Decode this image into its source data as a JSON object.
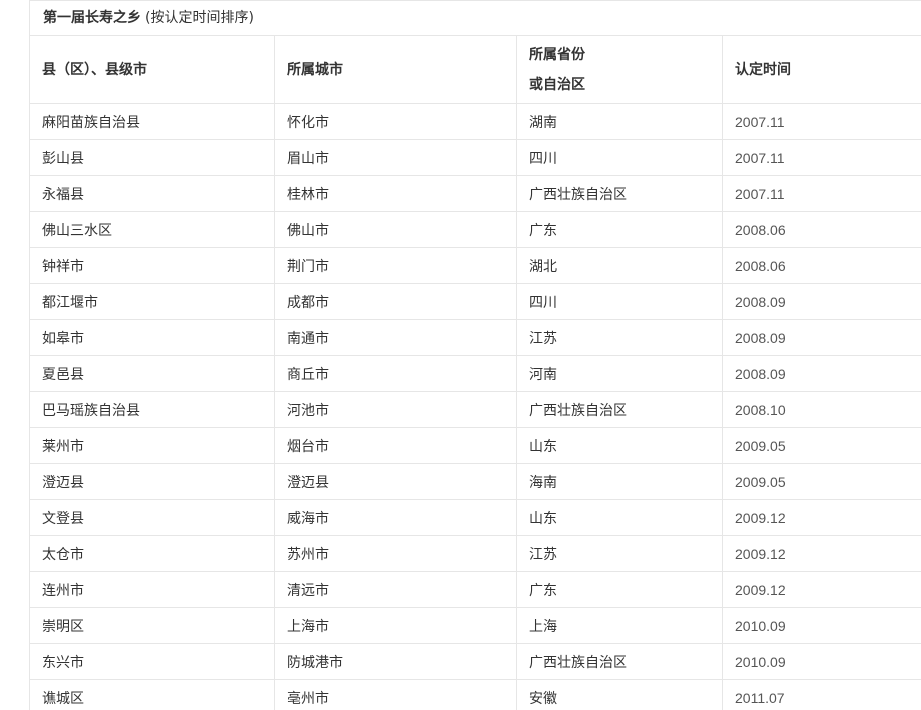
{
  "caption": {
    "title": "第一届长寿之乡",
    "note": "(按认定时间排序)"
  },
  "headers": {
    "county": "县（区）、县级市",
    "city": "所属城市",
    "province_line1": "所属省份",
    "province_line2": "或自治区",
    "date": "认定时间"
  },
  "rows": [
    {
      "county": "麻阳苗族自治县",
      "city": "怀化市",
      "province": "湖南",
      "date": "2007.11"
    },
    {
      "county": "彭山县",
      "city": "眉山市",
      "province": "四川",
      "date": "2007.11"
    },
    {
      "county": "永福县",
      "city": "桂林市",
      "province": "广西壮族自治区",
      "date": "2007.11"
    },
    {
      "county": "佛山三水区",
      "city": "佛山市",
      "province": "广东",
      "date": "2008.06"
    },
    {
      "county": "钟祥市",
      "city": "荆门市",
      "province": "湖北",
      "date": "2008.06"
    },
    {
      "county": "都江堰市",
      "city": "成都市",
      "province": "四川",
      "date": "2008.09"
    },
    {
      "county": "如皋市",
      "city": "南通市",
      "province": "江苏",
      "date": "2008.09"
    },
    {
      "county": "夏邑县",
      "city": "商丘市",
      "province": "河南",
      "date": "2008.09"
    },
    {
      "county": "巴马瑶族自治县",
      "city": "河池市",
      "province": "广西壮族自治区",
      "date": "2008.10"
    },
    {
      "county": "莱州市",
      "city": "烟台市",
      "province": "山东",
      "date": "2009.05"
    },
    {
      "county": "澄迈县",
      "city": "澄迈县",
      "province": "海南",
      "date": "2009.05"
    },
    {
      "county": "文登县",
      "city": "威海市",
      "province": "山东",
      "date": "2009.12"
    },
    {
      "county": "太仓市",
      "city": "苏州市",
      "province": "江苏",
      "date": "2009.12"
    },
    {
      "county": "连州市",
      "city": "清远市",
      "province": "广东",
      "date": "2009.12"
    },
    {
      "county": "崇明区",
      "city": "上海市",
      "province": "上海",
      "date": "2010.09"
    },
    {
      "county": "东兴市",
      "city": "防城港市",
      "province": "广西壮族自治区",
      "date": "2010.09"
    },
    {
      "county": "谯城区",
      "city": "亳州市",
      "province": "安徽",
      "date": "2011.07"
    }
  ]
}
